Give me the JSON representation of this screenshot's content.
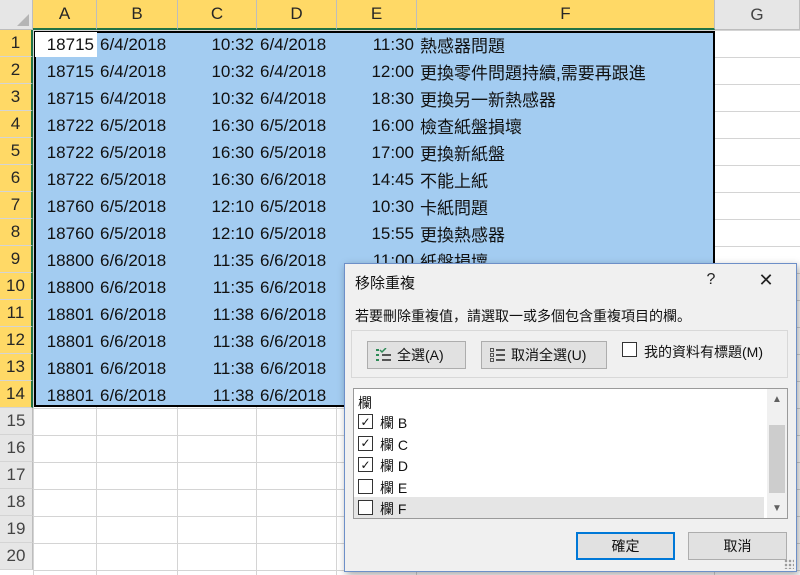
{
  "sheet": {
    "columns": [
      "A",
      "B",
      "C",
      "D",
      "E",
      "F",
      "G"
    ],
    "rows": [
      "1",
      "2",
      "3",
      "4",
      "5",
      "6",
      "7",
      "8",
      "9",
      "10",
      "11",
      "12",
      "13",
      "14",
      "15",
      "16",
      "17",
      "18",
      "19",
      "20"
    ],
    "data": [
      [
        "18715",
        "6/4/2018",
        "10:32",
        "6/4/2018",
        "11:30",
        "熱感器問題"
      ],
      [
        "18715",
        "6/4/2018",
        "10:32",
        "6/4/2018",
        "12:00",
        "更換零件問題持續,需要再跟進"
      ],
      [
        "18715",
        "6/4/2018",
        "10:32",
        "6/4/2018",
        "18:30",
        "更換另一新熱感器"
      ],
      [
        "18722",
        "6/5/2018",
        "16:30",
        "6/5/2018",
        "16:00",
        "檢查紙盤損壞"
      ],
      [
        "18722",
        "6/5/2018",
        "16:30",
        "6/5/2018",
        "17:00",
        "更換新紙盤"
      ],
      [
        "18722",
        "6/5/2018",
        "16:30",
        "6/6/2018",
        "14:45",
        "不能上紙"
      ],
      [
        "18760",
        "6/5/2018",
        "12:10",
        "6/5/2018",
        "10:30",
        "卡紙問題"
      ],
      [
        "18760",
        "6/5/2018",
        "12:10",
        "6/5/2018",
        "15:55",
        "更換熱感器"
      ],
      [
        "18800",
        "6/6/2018",
        "11:35",
        "6/6/2018",
        "11:00",
        "紙盤損壞"
      ],
      [
        "18800",
        "6/6/2018",
        "11:35",
        "6/6/2018",
        "",
        ""
      ],
      [
        "18801",
        "6/6/2018",
        "11:38",
        "6/6/2018",
        "",
        ""
      ],
      [
        "18801",
        "6/6/2018",
        "11:38",
        "6/6/2018",
        "",
        ""
      ],
      [
        "18801",
        "6/6/2018",
        "11:38",
        "6/6/2018",
        "",
        ""
      ],
      [
        "18801",
        "6/6/2018",
        "11:38",
        "6/6/2018",
        "",
        ""
      ]
    ]
  },
  "dialog": {
    "title": "移除重複",
    "help": "?",
    "close": "✕",
    "description": "若要刪除重複值，請選取一或多個包含重複項目的欄。",
    "select_all": "全選(A)",
    "unselect_all": "取消全選(U)",
    "has_headers_label": "我的資料有標題(M)",
    "has_headers_checked": false,
    "list_header": "欄",
    "items": [
      {
        "label": "欄 B",
        "checked": true
      },
      {
        "label": "欄 C",
        "checked": true
      },
      {
        "label": "欄 D",
        "checked": true
      },
      {
        "label": "欄 E",
        "checked": false
      },
      {
        "label": "欄 F",
        "checked": false
      }
    ],
    "ok": "確定",
    "cancel": "取消",
    "check_glyph": "✓"
  },
  "colors": {
    "selection": "#a3ccf1",
    "header_selected": "#ffd966",
    "accent": "#217346",
    "ok_border": "#0078d7"
  }
}
